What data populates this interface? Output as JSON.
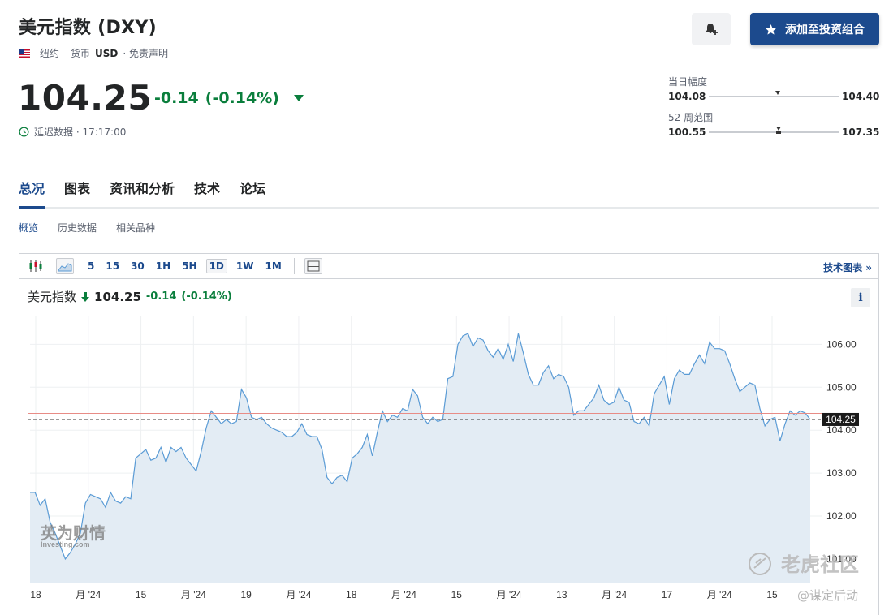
{
  "header": {
    "title": "美元指数 (DXY)",
    "location": "纽约",
    "currency_label": "货币",
    "currency": "USD",
    "disclaimer": "· 免责声明",
    "portfolio_button": "添加至投资组合"
  },
  "quote": {
    "price": "104.25",
    "change": "-0.14",
    "change_pct": "(-0.14%)",
    "delay_text": "延迟数据 · 17:17:00"
  },
  "ranges": {
    "day": {
      "label": "当日幅度",
      "low": "104.08",
      "high": "104.40",
      "position": 0.53
    },
    "week52": {
      "label": "52 周范围",
      "low": "100.55",
      "high": "107.35",
      "position": 0.54
    }
  },
  "tabs": [
    "总况",
    "图表",
    "资讯和分析",
    "技术",
    "论坛"
  ],
  "subtabs": [
    "概览",
    "历史数据",
    "相关品种"
  ],
  "toolbar": {
    "ranges": [
      "5",
      "15",
      "30",
      "1H",
      "5H",
      "1D",
      "1W",
      "1M"
    ],
    "selected_range": "1D",
    "advanced_link": "技术图表 »"
  },
  "chart_head": {
    "name": "美元指数",
    "price": "104.25",
    "change": "-0.14",
    "change_pct": "(-0.14%)"
  },
  "chart_data": {
    "type": "area",
    "y_ticks": [
      {
        "value": 106,
        "label": "106.00"
      },
      {
        "value": 105,
        "label": "105.00"
      },
      {
        "value": 104,
        "label": "104.00"
      },
      {
        "value": 103,
        "label": "103.00"
      },
      {
        "value": 102,
        "label": "102.00"
      },
      {
        "value": 101,
        "label": "101.00"
      }
    ],
    "ylim": [
      100.45,
      106.65
    ],
    "last_price_label": "104.25",
    "last_price": 104.25,
    "prev_close": 104.39,
    "x_ticks": [
      "18",
      "月 '24",
      "15",
      "月 '24",
      "19",
      "月 '24",
      "18",
      "月 '24",
      "15",
      "月 '24",
      "13",
      "月 '24",
      "17",
      "月 '24",
      "15"
    ],
    "values": [
      102.55,
      102.55,
      102.25,
      102.4,
      101.85,
      101.6,
      101.3,
      101.0,
      101.15,
      101.35,
      101.6,
      102.3,
      102.5,
      102.45,
      102.4,
      102.2,
      102.55,
      102.35,
      102.3,
      102.45,
      102.4,
      103.35,
      103.45,
      103.55,
      103.3,
      103.35,
      103.6,
      103.25,
      103.6,
      103.5,
      103.6,
      103.35,
      103.2,
      103.05,
      103.5,
      104.05,
      104.45,
      104.3,
      104.15,
      104.25,
      104.15,
      104.2,
      104.95,
      104.75,
      104.3,
      104.25,
      104.3,
      104.15,
      104.05,
      104.0,
      103.95,
      103.85,
      103.85,
      103.95,
      104.15,
      103.9,
      103.85,
      103.85,
      103.55,
      102.9,
      102.75,
      102.9,
      102.95,
      102.8,
      103.35,
      103.45,
      103.6,
      103.9,
      103.4,
      103.95,
      104.45,
      104.2,
      104.35,
      104.3,
      104.5,
      104.45,
      104.95,
      104.8,
      104.3,
      104.15,
      104.3,
      104.2,
      104.25,
      105.2,
      105.25,
      106.0,
      106.2,
      106.25,
      105.95,
      106.15,
      106.1,
      105.85,
      105.7,
      105.9,
      105.65,
      106.0,
      105.6,
      106.25,
      105.8,
      105.3,
      105.05,
      105.05,
      105.35,
      105.5,
      105.2,
      105.3,
      105.25,
      105.0,
      104.35,
      104.45,
      104.45,
      104.6,
      104.75,
      105.05,
      104.7,
      104.6,
      104.65,
      105.0,
      104.7,
      104.65,
      104.2,
      104.15,
      104.3,
      104.1,
      104.85,
      105.05,
      105.25,
      104.6,
      105.2,
      105.4,
      105.3,
      105.3,
      105.55,
      105.75,
      105.55,
      106.05,
      105.9,
      105.9,
      105.85,
      105.55,
      105.2,
      104.9,
      105.0,
      105.1,
      105.05,
      104.5,
      104.1,
      104.25,
      104.3,
      103.75,
      104.15,
      104.45,
      104.35,
      104.45,
      104.4,
      104.25
    ]
  },
  "watermarks": {
    "logo_cn": "英为财情",
    "logo_en": "Investing.com",
    "community": "老虎社区",
    "author": "@谋定后动"
  },
  "colors": {
    "brand_blue": "#1c4a8d",
    "down_green": "#0a7e3c",
    "line": "#5a9bd5",
    "area": "#e3ecf4",
    "prev_close_line": "#e88c86"
  }
}
